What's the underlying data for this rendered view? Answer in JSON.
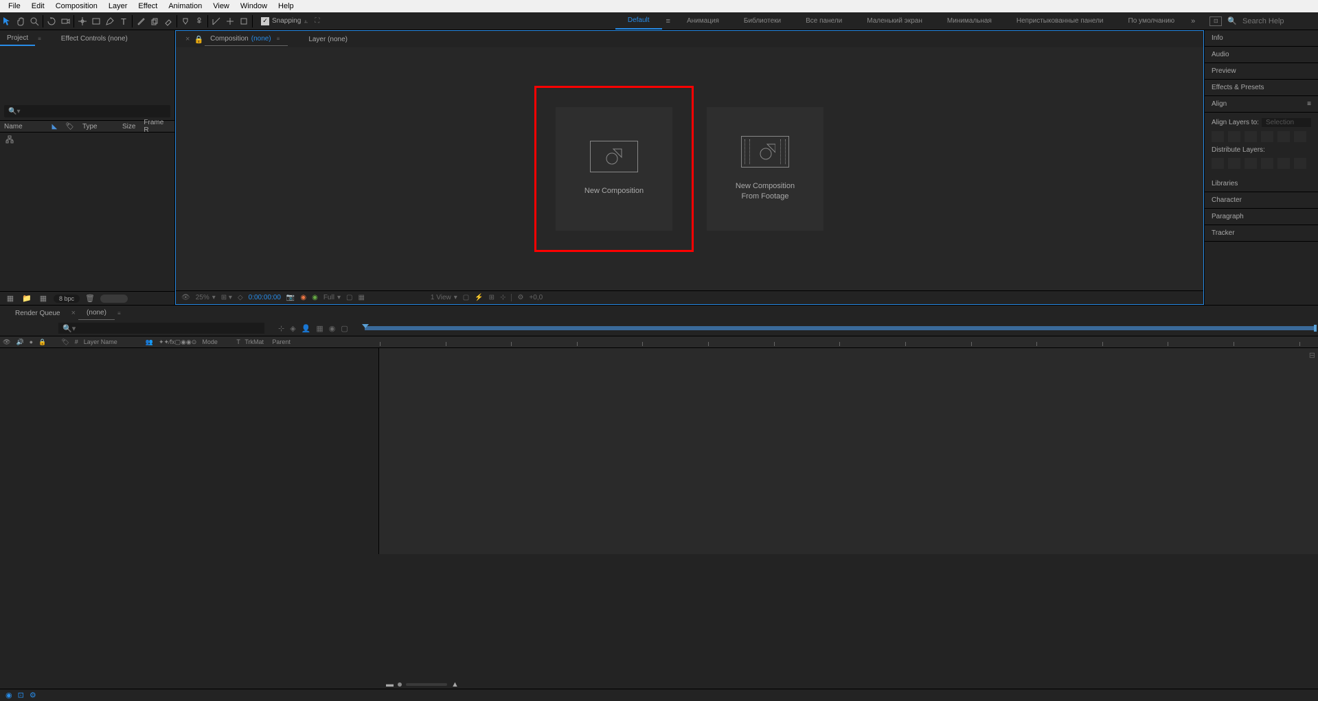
{
  "menubar": [
    "File",
    "Edit",
    "Composition",
    "Layer",
    "Effect",
    "Animation",
    "View",
    "Window",
    "Help"
  ],
  "toolbar": {
    "snapping_label": "Snapping",
    "search_placeholder": "Search Help"
  },
  "workspaces": {
    "items": [
      "Default",
      "Анимация",
      "Библиотеки",
      "Все панели",
      "Маленький экран",
      "Минимальная",
      "Непристыкованные панели",
      "По умолчанию"
    ],
    "active": 0
  },
  "left_panel": {
    "tabs": {
      "project": "Project",
      "effect_controls": "Effect Controls (none)"
    },
    "columns": {
      "name": "Name",
      "type": "Type",
      "size": "Size",
      "framer": "Frame R"
    },
    "bpc": "8 bpc"
  },
  "center": {
    "tabs": {
      "composition_label": "Composition",
      "composition_none": "(none)",
      "layer_label": "Layer (none)"
    },
    "cards": {
      "new_comp": "New Composition",
      "new_comp_footage": "New Composition\nFrom Footage"
    },
    "footer": {
      "zoom": "25%",
      "timecode": "0:00:00:00",
      "resolution": "Full",
      "view": "1 View",
      "exposure": "+0,0"
    }
  },
  "right_panel": {
    "sections": [
      "Info",
      "Audio",
      "Preview",
      "Effects & Presets",
      "Align",
      "Libraries",
      "Character",
      "Paragraph",
      "Tracker"
    ],
    "align": {
      "align_layers_to": "Align Layers to:",
      "selection": "Selection",
      "distribute_layers": "Distribute Layers:"
    }
  },
  "timeline": {
    "tabs": {
      "render_queue": "Render Queue",
      "none": "(none)"
    },
    "timecode": "",
    "columns": {
      "layer_name": "Layer Name",
      "mode": "Mode",
      "trkmat": "TrkMat",
      "parent": "Parent",
      "t": "T"
    }
  }
}
